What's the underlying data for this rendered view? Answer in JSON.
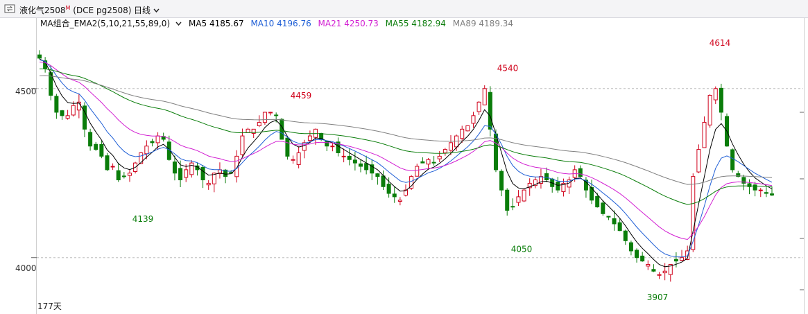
{
  "header": {
    "symbol_label": "液化气2508",
    "symbol_mark": "M",
    "symbol_code": "(DCE pg2508)",
    "period": "日线",
    "dropdown_icon": "chevron-down-icon",
    "menu_icon": "switch-icon"
  },
  "legend": {
    "group": "MA组合_EMA2(5,10,21,55,89,0)",
    "ma5": "MA5 4185.67",
    "ma10": "MA10 4196.76",
    "ma21": "MA21 4250.73",
    "ma55": "MA55 4182.94",
    "ma89": "MA89 4189.34"
  },
  "footer": {
    "days": "177天"
  },
  "colors": {
    "up": "#d0021b",
    "down": "#0a7d0a",
    "ma5": "#000000",
    "ma10": "#1f5fd6",
    "ma21": "#d21fd2",
    "ma55": "#0a7d0a",
    "ma89": "#808080"
  },
  "chart_data": {
    "type": "candlestick",
    "ylim": [
      3860,
      4680
    ],
    "y_ticks": [
      "4500",
      "4000"
    ],
    "annotations": [
      {
        "text": "4459",
        "value": 4459,
        "kind": "high"
      },
      {
        "text": "4139",
        "value": 4139,
        "kind": "low"
      },
      {
        "text": "4540",
        "value": 4540,
        "kind": "high"
      },
      {
        "text": "4050",
        "value": 4050,
        "kind": "low"
      },
      {
        "text": "4614",
        "value": 4614,
        "kind": "high"
      },
      {
        "text": "3907",
        "value": 3907,
        "kind": "low"
      }
    ],
    "close": [
      4590,
      4560,
      4480,
      4430,
      4420,
      4420,
      4450,
      4460,
      4380,
      4330,
      4320,
      4300,
      4260,
      4270,
      4230,
      4240,
      4250,
      4280,
      4310,
      4330,
      4340,
      4360,
      4350,
      4290,
      4250,
      4230,
      4260,
      4280,
      4260,
      4230,
      4220,
      4250,
      4260,
      4240,
      4250,
      4300,
      4360,
      4380,
      4380,
      4400,
      4430,
      4430,
      4420,
      4350,
      4300,
      4290,
      4310,
      4340,
      4360,
      4380,
      4350,
      4330,
      4330,
      4310,
      4300,
      4290,
      4280,
      4270,
      4260,
      4250,
      4240,
      4210,
      4190,
      4180,
      4170,
      4200,
      4240,
      4270,
      4280,
      4290,
      4280,
      4300,
      4320,
      4340,
      4360,
      4380,
      4390,
      4420,
      4460,
      4500,
      4380,
      4260,
      4200,
      4140,
      4150,
      4180,
      4200,
      4220,
      4230,
      4240,
      4230,
      4210,
      4200,
      4220,
      4230,
      4260,
      4240,
      4200,
      4170,
      4150,
      4130,
      4120,
      4100,
      4080,
      4050,
      4020,
      4000,
      3990,
      3980,
      3960,
      3950,
      3960,
      3980,
      3990,
      4000,
      4020,
      4240,
      4320,
      4400,
      4480,
      4500,
      4430,
      4330,
      4260,
      4240,
      4220,
      4210,
      4200,
      4200,
      4190,
      4185
    ]
  }
}
